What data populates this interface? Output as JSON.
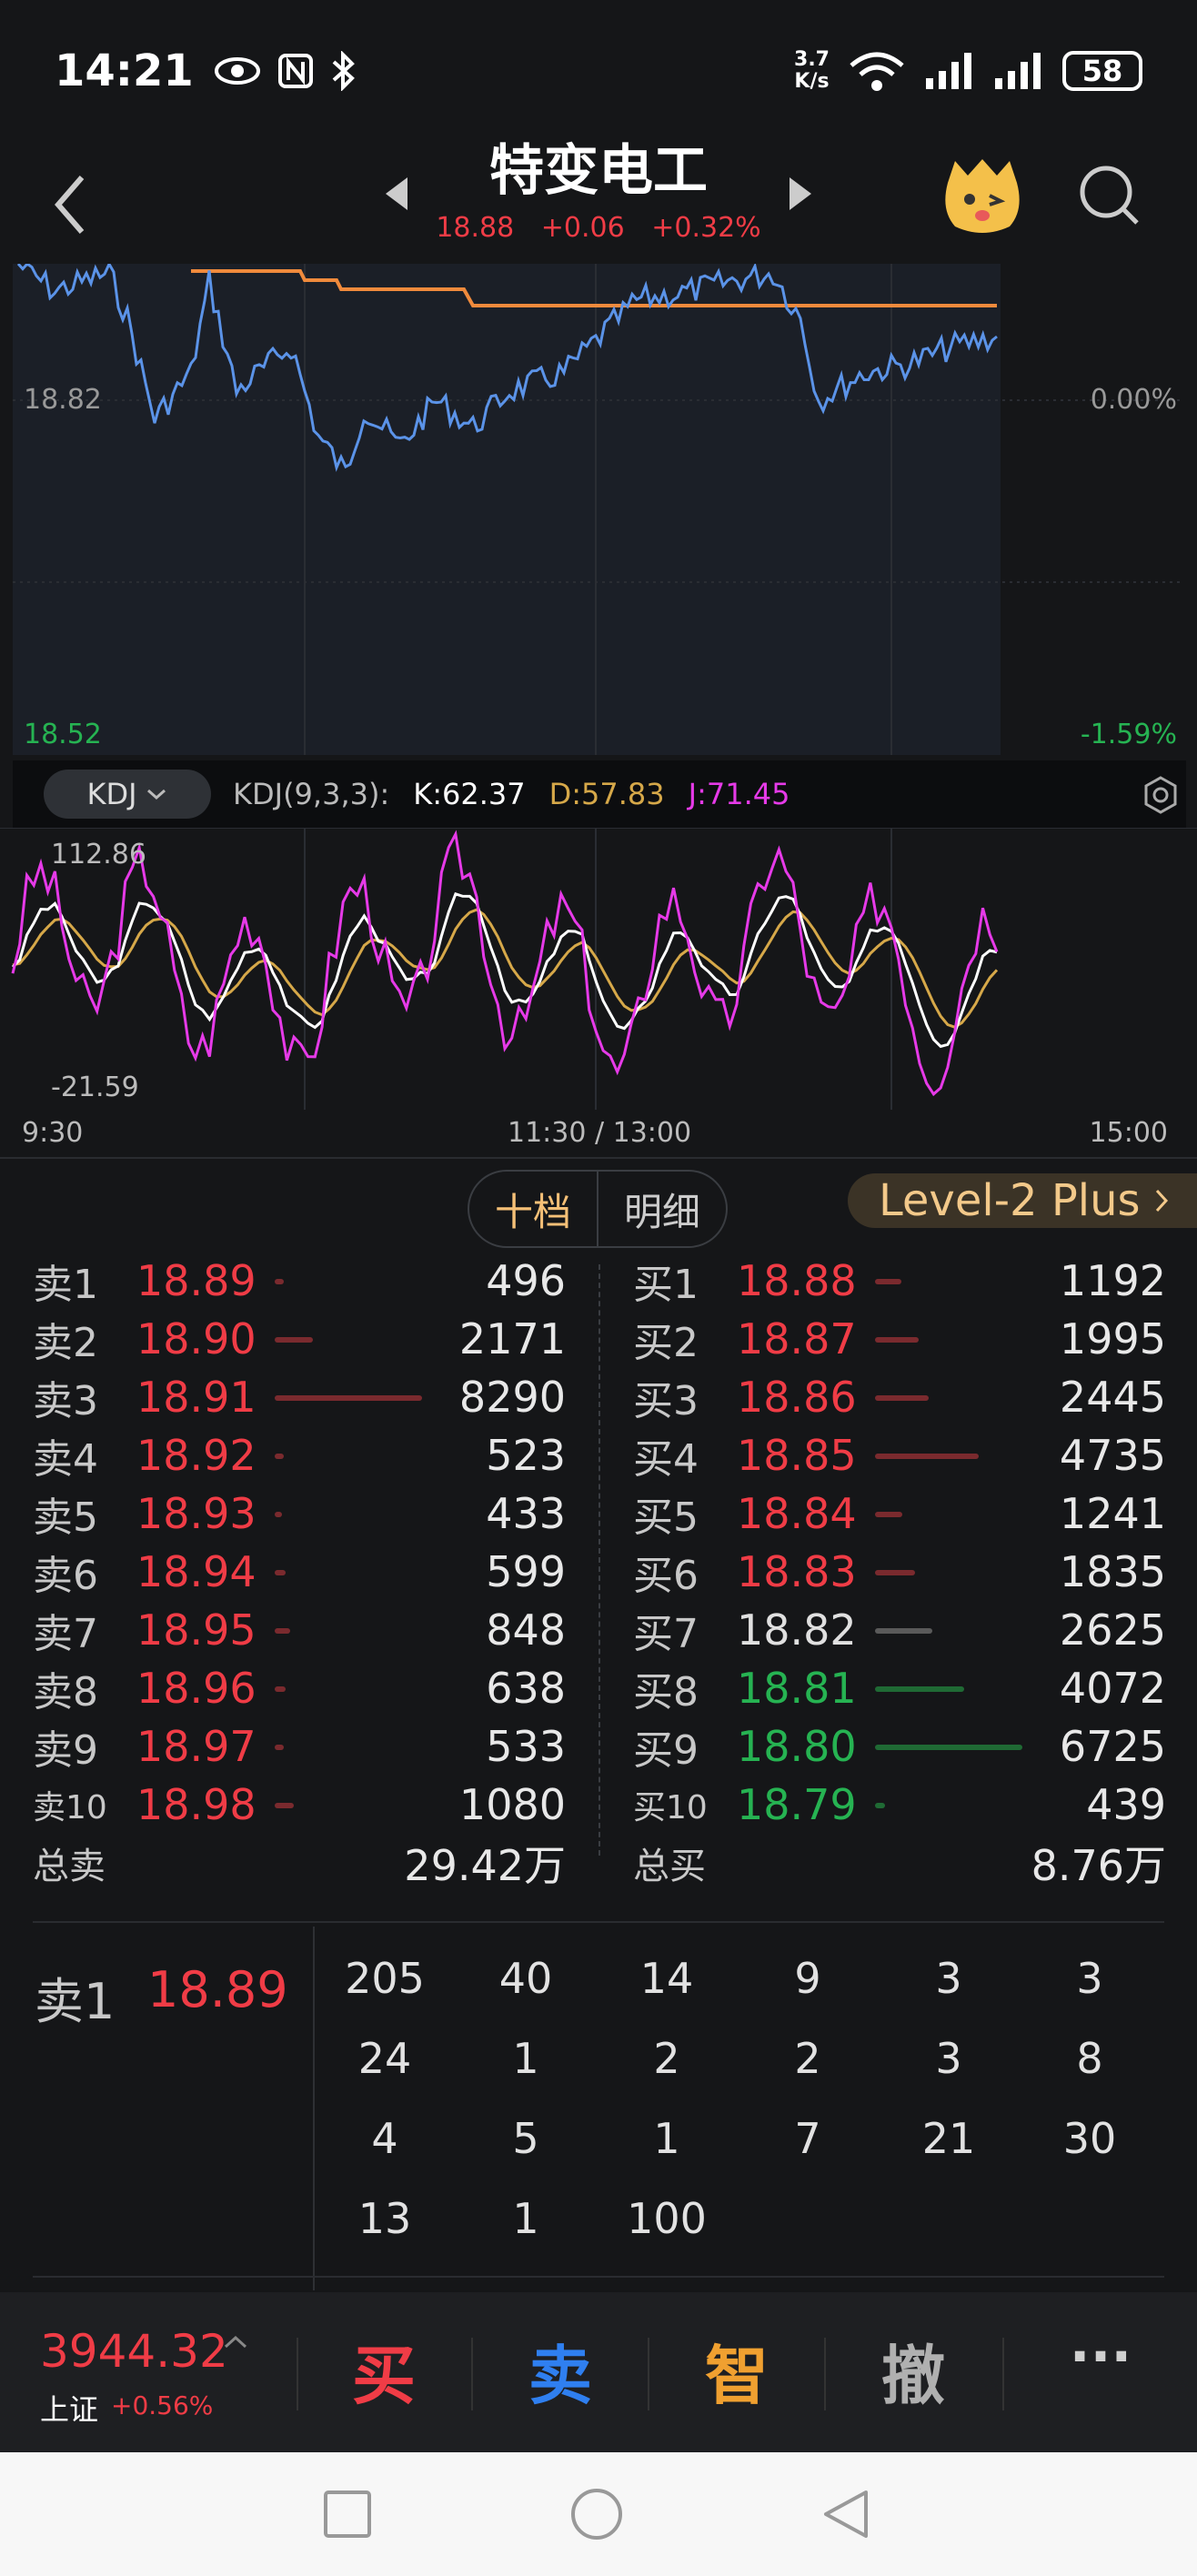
{
  "status_bar": {
    "time": "14:21",
    "net_speed_value": "3.7",
    "net_speed_unit": "K/s",
    "battery": "58",
    "icons": [
      "eye-icon",
      "nfc-icon",
      "bluetooth-icon",
      "wifi-icon",
      "signal-icon",
      "signal-icon"
    ]
  },
  "header": {
    "title": "特变电工",
    "price": "18.88",
    "change": "+0.06",
    "change_pct": "+0.32%"
  },
  "price_chart": {
    "high_price": "18.82",
    "low_price": "18.52",
    "high_pct": "0.00%",
    "low_pct": "-1.59%",
    "colors": {
      "price_line": "#5b93e8",
      "avg_line": "#f08a3c",
      "up": "#f03c46",
      "down": "#26b352"
    }
  },
  "kdj": {
    "button_label": "KDJ",
    "params": "KDJ(9,3,3):",
    "k": "K:62.37",
    "d": "D:57.83",
    "j": "J:71.45",
    "axis_max": "112.86",
    "axis_min": "-21.59",
    "colors": {
      "k": "#ffffff",
      "d": "#d6a849",
      "j": "#e63ae8"
    }
  },
  "time_axis": {
    "start": "9:30",
    "mid": "11:30 / 13:00",
    "end": "15:00"
  },
  "tabs": [
    "十档",
    "明细"
  ],
  "level2_label": "Level-2 Plus",
  "sell_orders": [
    {
      "label": "卖1",
      "price": "18.89",
      "volume": "496",
      "color": "#f03c46"
    },
    {
      "label": "卖2",
      "price": "18.90",
      "volume": "2171",
      "color": "#f03c46"
    },
    {
      "label": "卖3",
      "price": "18.91",
      "volume": "8290",
      "color": "#f03c46"
    },
    {
      "label": "卖4",
      "price": "18.92",
      "volume": "523",
      "color": "#f03c46"
    },
    {
      "label": "卖5",
      "price": "18.93",
      "volume": "433",
      "color": "#f03c46"
    },
    {
      "label": "卖6",
      "price": "18.94",
      "volume": "599",
      "color": "#f03c46"
    },
    {
      "label": "卖7",
      "price": "18.95",
      "volume": "848",
      "color": "#f03c46"
    },
    {
      "label": "卖8",
      "price": "18.96",
      "volume": "638",
      "color": "#f03c46"
    },
    {
      "label": "卖9",
      "price": "18.97",
      "volume": "533",
      "color": "#f03c46"
    },
    {
      "label": "卖10",
      "price": "18.98",
      "volume": "1080",
      "color": "#f03c46"
    }
  ],
  "buy_orders": [
    {
      "label": "买1",
      "price": "18.88",
      "volume": "1192",
      "color": "#f03c46"
    },
    {
      "label": "买2",
      "price": "18.87",
      "volume": "1995",
      "color": "#f03c46"
    },
    {
      "label": "买3",
      "price": "18.86",
      "volume": "2445",
      "color": "#f03c46"
    },
    {
      "label": "买4",
      "price": "18.85",
      "volume": "4735",
      "color": "#f03c46"
    },
    {
      "label": "买5",
      "price": "18.84",
      "volume": "1241",
      "color": "#f03c46"
    },
    {
      "label": "买6",
      "price": "18.83",
      "volume": "1835",
      "color": "#f03c46"
    },
    {
      "label": "买7",
      "price": "18.82",
      "volume": "2625",
      "color": "#e0e0e0"
    },
    {
      "label": "买8",
      "price": "18.81",
      "volume": "4072",
      "color": "#26b352"
    },
    {
      "label": "买9",
      "price": "18.80",
      "volume": "6725",
      "color": "#26b352"
    },
    {
      "label": "买10",
      "price": "18.79",
      "volume": "439",
      "color": "#26b352"
    }
  ],
  "totals": {
    "sell_label": "总卖",
    "sell_value": "29.42万",
    "buy_label": "总买",
    "buy_value": "8.76万"
  },
  "queue": {
    "label": "卖1",
    "price": "18.89",
    "orders": [
      "205",
      "40",
      "14",
      "9",
      "3",
      "3",
      "24",
      "1",
      "2",
      "2",
      "3",
      "8",
      "4",
      "5",
      "1",
      "7",
      "21",
      "30",
      "13",
      "1",
      "100"
    ]
  },
  "trade_bar": {
    "index_value": "3944.32",
    "index_name": "上证",
    "index_change": "+0.56%",
    "buttons": [
      {
        "label": "买",
        "color": "#f03c46"
      },
      {
        "label": "卖",
        "color": "#2f7ff0"
      },
      {
        "label": "智",
        "color": "#f0a030"
      },
      {
        "label": "撤",
        "color": "#b0b0b0"
      },
      {
        "label": "···",
        "color": "#d0d0d0"
      }
    ]
  }
}
